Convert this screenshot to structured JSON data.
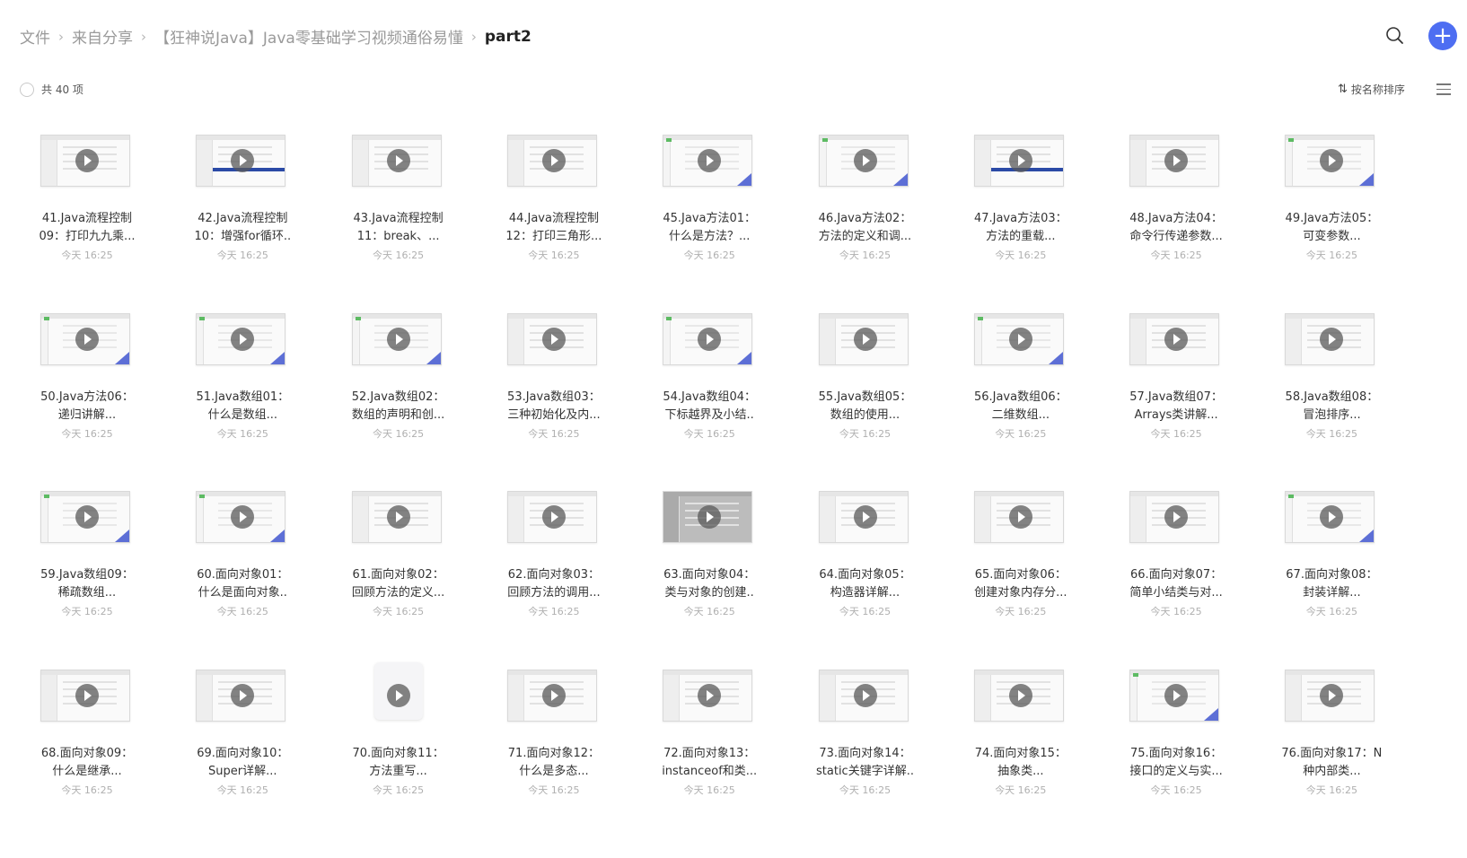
{
  "breadcrumb": [
    "文件",
    "来自分享",
    "【狂神说Java】Java零基础学习视频通俗易懂",
    "part2"
  ],
  "toolbar": {
    "count_label": "共 40 项",
    "sort_label": "按名称排序"
  },
  "icons": {
    "search": "search-icon",
    "add": "plus-icon",
    "sort": "sort-arrows-icon",
    "list_view": "list-view-icon",
    "play": "play-icon"
  },
  "accent_color": "#4e6ef2",
  "files": [
    {
      "line1": "41.Java流程控制",
      "line2": "09：打印九九乘...",
      "time": "今天 16:25",
      "style": "ide"
    },
    {
      "line1": "42.Java流程控制",
      "line2": "10：增强for循环..",
      "time": "今天 16:25",
      "style": "blue"
    },
    {
      "line1": "43.Java流程控制",
      "line2": "11：break、...",
      "time": "今天 16:25",
      "style": "ide"
    },
    {
      "line1": "44.Java流程控制",
      "line2": "12：打印三角形...",
      "time": "今天 16:25",
      "style": "ide"
    },
    {
      "line1": "45.Java方法01：",
      "line2": "什么是方法？...",
      "time": "今天 16:25",
      "style": "slide"
    },
    {
      "line1": "46.Java方法02：",
      "line2": "方法的定义和调...",
      "time": "今天 16:25",
      "style": "slide"
    },
    {
      "line1": "47.Java方法03：",
      "line2": "方法的重载...",
      "time": "今天 16:25",
      "style": "blue"
    },
    {
      "line1": "48.Java方法04：",
      "line2": "命令行传递参数...",
      "time": "今天 16:25",
      "style": "ide"
    },
    {
      "line1": "49.Java方法05：",
      "line2": "可变参数...",
      "time": "今天 16:25",
      "style": "slide"
    },
    {
      "line1": "50.Java方法06：",
      "line2": "递归讲解...",
      "time": "今天 16:25",
      "style": "slide"
    },
    {
      "line1": "51.Java数组01：",
      "line2": "什么是数组...",
      "time": "今天 16:25",
      "style": "slide"
    },
    {
      "line1": "52.Java数组02：",
      "line2": "数组的声明和创...",
      "time": "今天 16:25",
      "style": "slide"
    },
    {
      "line1": "53.Java数组03：",
      "line2": "三种初始化及内...",
      "time": "今天 16:25",
      "style": "ide"
    },
    {
      "line1": "54.Java数组04：",
      "line2": "下标越界及小结..",
      "time": "今天 16:25",
      "style": "slide"
    },
    {
      "line1": "55.Java数组05：",
      "line2": "数组的使用...",
      "time": "今天 16:25",
      "style": "ide"
    },
    {
      "line1": "56.Java数组06：",
      "line2": "二维数组...",
      "time": "今天 16:25",
      "style": "slide"
    },
    {
      "line1": "57.Java数组07：",
      "line2": "Arrays类讲解...",
      "time": "今天 16:25",
      "style": "ide"
    },
    {
      "line1": "58.Java数组08：",
      "line2": "冒泡排序...",
      "time": "今天 16:25",
      "style": "ide"
    },
    {
      "line1": "59.Java数组09：",
      "line2": "稀疏数组...",
      "time": "今天 16:25",
      "style": "slide"
    },
    {
      "line1": "60.面向对象01：",
      "line2": "什么是面向对象..",
      "time": "今天 16:25",
      "style": "slide"
    },
    {
      "line1": "61.面向对象02：",
      "line2": "回顾方法的定义...",
      "time": "今天 16:25",
      "style": "ide"
    },
    {
      "line1": "62.面向对象03：",
      "line2": "回顾方法的调用...",
      "time": "今天 16:25",
      "style": "ide"
    },
    {
      "line1": "63.面向对象04：",
      "line2": "类与对象的创建..",
      "time": "今天 16:25",
      "style": "grey"
    },
    {
      "line1": "64.面向对象05：",
      "line2": "构造器详解...",
      "time": "今天 16:25",
      "style": "ide"
    },
    {
      "line1": "65.面向对象06：",
      "line2": "创建对象内存分...",
      "time": "今天 16:25",
      "style": "ide"
    },
    {
      "line1": "66.面向对象07：",
      "line2": "简单小结类与对...",
      "time": "今天 16:25",
      "style": "ide"
    },
    {
      "line1": "67.面向对象08：",
      "line2": "封装详解...",
      "time": "今天 16:25",
      "style": "slide"
    },
    {
      "line1": "68.面向对象09：",
      "line2": "什么是继承...",
      "time": "今天 16:25",
      "style": "ide"
    },
    {
      "line1": "69.面向对象10：",
      "line2": "Super详解...",
      "time": "今天 16:25",
      "style": "ide"
    },
    {
      "line1": "70.面向对象11：",
      "line2": "方法重写...",
      "time": "今天 16:25",
      "style": "doc"
    },
    {
      "line1": "71.面向对象12：",
      "line2": "什么是多态...",
      "time": "今天 16:25",
      "style": "ide"
    },
    {
      "line1": "72.面向对象13：",
      "line2": "instanceof和类...",
      "time": "今天 16:25",
      "style": "ide"
    },
    {
      "line1": "73.面向对象14：",
      "line2": "static关键字详解..",
      "time": "今天 16:25",
      "style": "ide"
    },
    {
      "line1": "74.面向对象15：",
      "line2": "抽象类...",
      "time": "今天 16:25",
      "style": "ide"
    },
    {
      "line1": "75.面向对象16：",
      "line2": "接口的定义与实...",
      "time": "今天 16:25",
      "style": "slide"
    },
    {
      "line1": "76.面向对象17：N",
      "line2": "种内部类...",
      "time": "今天 16:25",
      "style": "ide"
    }
  ]
}
